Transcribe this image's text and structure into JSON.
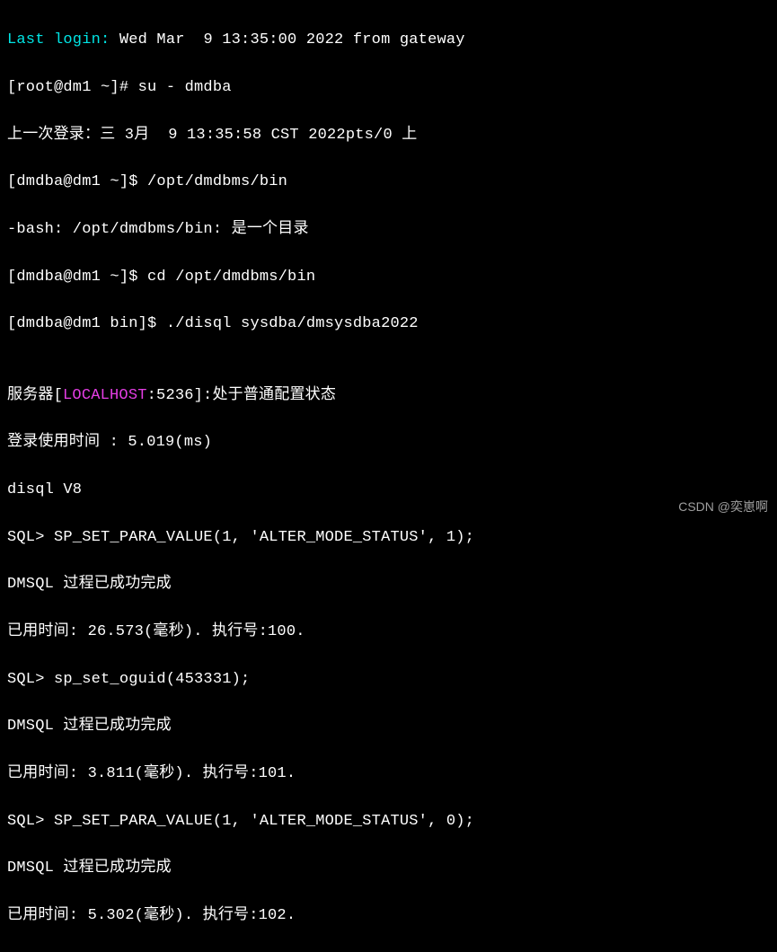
{
  "lines": {
    "l1a": "Last login:",
    "l1b": " Wed Mar  9 13:35:00 2022 from gateway",
    "l2": "[root@dm1 ~]# su - dmdba",
    "l3": "上一次登录：三 3月  9 13:35:58 CST 2022pts/0 上",
    "l4": "[dmdba@dm1 ~]$ /opt/dmdbms/bin",
    "l5": "-bash: /opt/dmdbms/bin: 是一个目录",
    "l6": "[dmdba@dm1 ~]$ cd /opt/dmdbms/bin",
    "l7": "[dmdba@dm1 bin]$ ./disql sysdba/dmsysdba2022",
    "l8": "",
    "l9a": "服务器[",
    "l9b": "LOCALHOST",
    "l9c": ":5236]:处于普通配置状态",
    "l10": "登录使用时间 : 5.019(ms)",
    "l11": "disql V8",
    "l12": "SQL> SP_SET_PARA_VALUE(1, 'ALTER_MODE_STATUS', 1);",
    "l13": "DMSQL 过程已成功完成",
    "l14": "已用时间: 26.573(毫秒). 执行号:100.",
    "l15": "SQL> sp_set_oguid(453331);",
    "l16": "DMSQL 过程已成功完成",
    "l17": "已用时间: 3.811(毫秒). 执行号:101.",
    "l18": "SQL> SP_SET_PARA_VALUE(1, 'ALTER_MODE_STATUS', 0);",
    "l19": "DMSQL 过程已成功完成",
    "l20": "已用时间: 5.302(毫秒). 执行号:102."
  },
  "watermark": "CSDN @奕崽啊"
}
